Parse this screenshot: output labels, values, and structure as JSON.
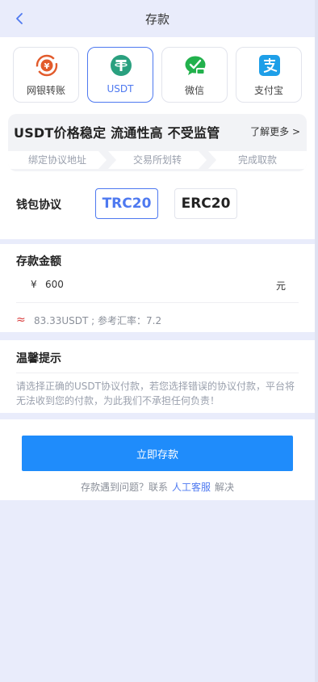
{
  "header": {
    "title": "存款"
  },
  "methods": [
    {
      "label": "网银转账",
      "icon": "bank-transfer-icon",
      "color": "#e25b2c"
    },
    {
      "label": "USDT",
      "icon": "tether-icon",
      "color": "#2aa07f"
    },
    {
      "label": "微信",
      "icon": "wechat-pay-icon",
      "color": "#22b14c"
    },
    {
      "label": "支付宝",
      "icon": "alipay-icon",
      "color": "#1e9fe8"
    }
  ],
  "banner": {
    "title": "USDT价格稳定 流通性高 不受监管",
    "more": "了解更多 >",
    "steps": [
      "绑定协议地址",
      "交易所划转",
      "完成取款"
    ]
  },
  "protocol": {
    "label": "钱包协议",
    "options": [
      "TRC20",
      "ERC20"
    ]
  },
  "amount": {
    "title": "存款金额",
    "currency": "¥",
    "value": "600",
    "unit": "元",
    "rate_symbol": "≈",
    "rate_text": "83.33USDT ; 参考汇率：7.2"
  },
  "tips": {
    "title": "温馨提示",
    "body": "请选择正确的USDT协议付款，若您选择错误的协议付款，平台将无法收到您的付款，为此我们不承担任何负责！"
  },
  "actions": {
    "submit": "立即存款",
    "help_prefix": "存款遇到问题？联系",
    "help_link": "人工客服",
    "help_suffix": "解决"
  },
  "colors": {
    "accent": "#4e79f0",
    "primary_button": "#1f8cfb",
    "page_bg": "#e9ecfb"
  }
}
